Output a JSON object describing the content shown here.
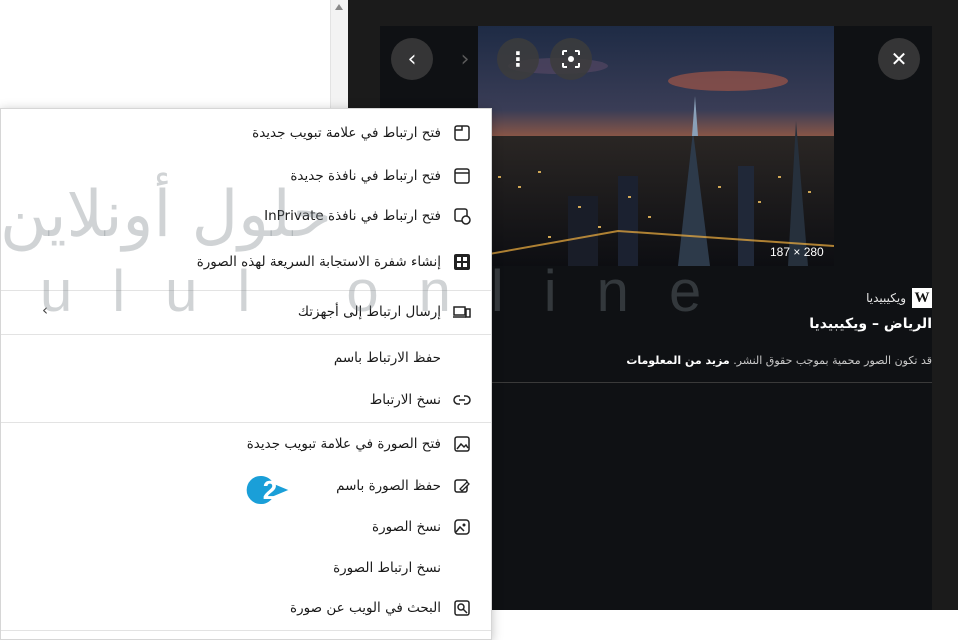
{
  "viewer": {
    "size_label": "187 × 280",
    "source_name": "ويكيبيديا",
    "source_icon_letter": "W",
    "image_title": "الرياض – ويكيبيديا",
    "copyright_text": "قد تكون الصور محمية بموجب حقوق النشر.",
    "learn_more": "مزيد من المعلومات",
    "buttons": {
      "prev": "‹",
      "next": "›",
      "more": "⋮",
      "lens": "visual-search",
      "close": "✕"
    }
  },
  "menu": {
    "items": [
      {
        "label": "فتح ارتباط في علامة تبويب جديدة",
        "icon": "new-tab-icon"
      },
      {
        "label": "فتح ارتباط في نافذة جديدة",
        "icon": "new-window-icon"
      },
      {
        "label": "فتح ارتباط في نافذة InPrivate",
        "icon": "inprivate-window-icon"
      },
      {
        "label": "إنشاء شفرة الاستجابة السريعة لهذه الصورة",
        "icon": "qr-code-icon"
      },
      {
        "label": "إرسال ارتباط إلى أجهزتك",
        "icon": "send-to-devices-icon"
      },
      {
        "label": "حفظ الارتباط باسم",
        "icon": ""
      },
      {
        "label": "نسخ الارتباط",
        "icon": "link-icon"
      },
      {
        "label": "فتح الصورة في علامة تبويب جديدة",
        "icon": "open-image-tab-icon"
      },
      {
        "label": "حفظ الصورة باسم",
        "icon": "save-image-icon"
      },
      {
        "label": "نسخ الصورة",
        "icon": "copy-image-icon"
      },
      {
        "label": "نسخ ارتباط الصورة",
        "icon": ""
      },
      {
        "label": "البحث في الويب عن صورة",
        "icon": "image-search-icon"
      }
    ]
  },
  "annotation": {
    "step_number": "2",
    "color": "#1a9fd8"
  },
  "watermark": {
    "latin": "ulul online",
    "arabic": "حلول أونلاين"
  },
  "colors": {
    "viewer_bg": "#0f1114",
    "menu_bg": "#ffffff",
    "accent": "#1a9fd8"
  }
}
